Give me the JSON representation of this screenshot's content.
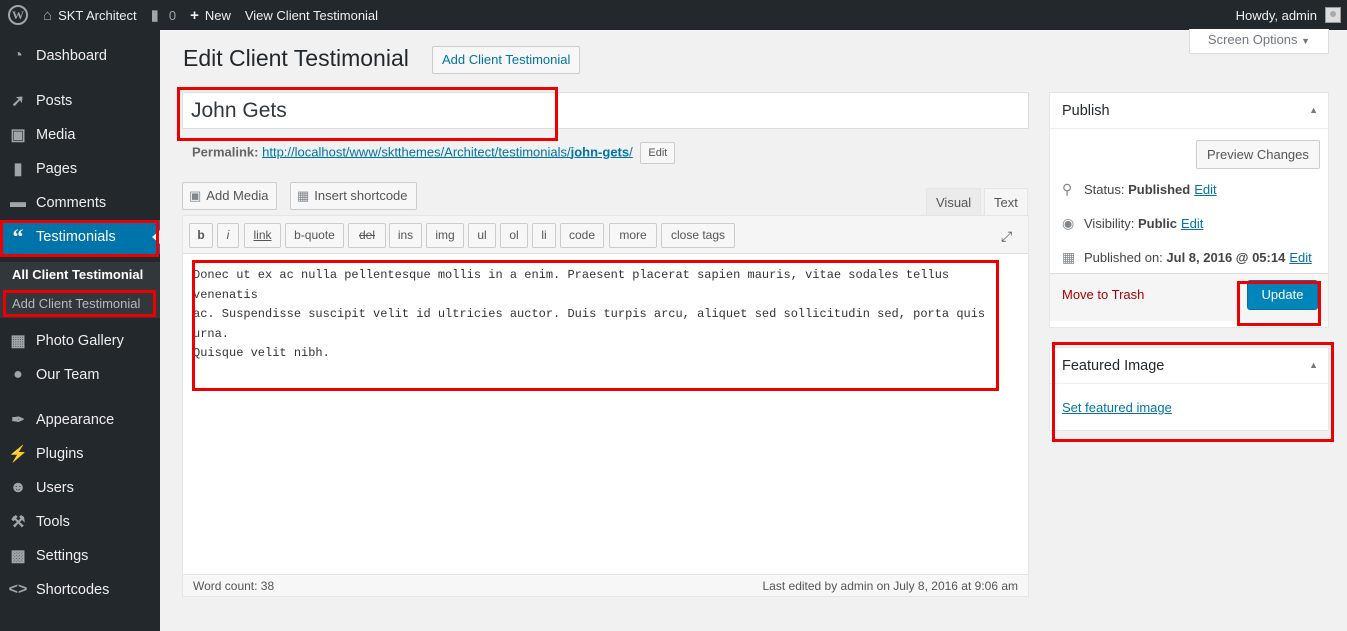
{
  "adminbar": {
    "site_name": "SKT Architect",
    "comments_count": "0",
    "new_label": "New",
    "view_label": "View Client Testimonial",
    "howdy": "Howdy, admin"
  },
  "sidebar": {
    "items": [
      {
        "label": "Dashboard",
        "icon": "dashboard-icon"
      },
      {
        "label": "Posts",
        "icon": "pin-icon"
      },
      {
        "label": "Media",
        "icon": "media-icon"
      },
      {
        "label": "Pages",
        "icon": "pages-icon"
      },
      {
        "label": "Comments",
        "icon": "comment-icon"
      },
      {
        "label": "Testimonials",
        "icon": "quote-icon"
      },
      {
        "label": "Photo Gallery",
        "icon": "image-icon"
      },
      {
        "label": "Our Team",
        "icon": "group-icon"
      },
      {
        "label": "Appearance",
        "icon": "brush-icon"
      },
      {
        "label": "Plugins",
        "icon": "plugin-icon"
      },
      {
        "label": "Users",
        "icon": "user-icon"
      },
      {
        "label": "Tools",
        "icon": "wrench-icon"
      },
      {
        "label": "Settings",
        "icon": "settings-icon"
      },
      {
        "label": "Shortcodes",
        "icon": "code-icon"
      }
    ],
    "submenu": [
      "All Client Testimonial",
      "Add Client Testimonial"
    ]
  },
  "main": {
    "page_title": "Edit Client Testimonial",
    "add_new_label": "Add Client Testimonial",
    "screen_options": "Screen Options",
    "post_title": "John Gets",
    "permalink_label": "Permalink:",
    "permalink_base": "http://localhost/www/sktthemes/Architect/testimonials/",
    "permalink_slug": "john-gets",
    "permalink_trailing": "/",
    "edit_label": "Edit",
    "add_media_label": "Add Media",
    "insert_shortcode_label": "Insert shortcode",
    "tab_visual": "Visual",
    "tab_text": "Text",
    "quicktags": [
      "b",
      "i",
      "link",
      "b-quote",
      "del",
      "ins",
      "img",
      "ul",
      "ol",
      "li",
      "code",
      "more",
      "close tags"
    ],
    "content_lines": [
      "Donec ut ex ac nulla pellentesque mollis in a enim. Praesent placerat sapien mauris, vitae sodales tellus venenatis",
      "ac. Suspendisse suscipit velit id ultricies auctor. Duis turpis arcu, aliquet sed sollicitudin sed, porta quis urna.",
      "Quisque velit nibh."
    ],
    "word_count": "Word count: 38",
    "last_edited": "Last edited by admin on July 8, 2016 at 9:06 am"
  },
  "publish": {
    "title": "Publish",
    "preview_label": "Preview Changes",
    "status_label": "Status:",
    "status_value": "Published",
    "visibility_label": "Visibility:",
    "visibility_value": "Public",
    "published_label": "Published on:",
    "published_value": "Jul 8, 2016 @ 05:14",
    "edit_link": "Edit",
    "trash_label": "Move to Trash",
    "update_label": "Update"
  },
  "featured": {
    "title": "Featured Image",
    "set_label": "Set featured image"
  },
  "colors": {
    "admin_dark": "#23282d",
    "accent_blue": "#0073aa",
    "update_blue": "#0085ba",
    "highlight_red": "#e00000"
  }
}
